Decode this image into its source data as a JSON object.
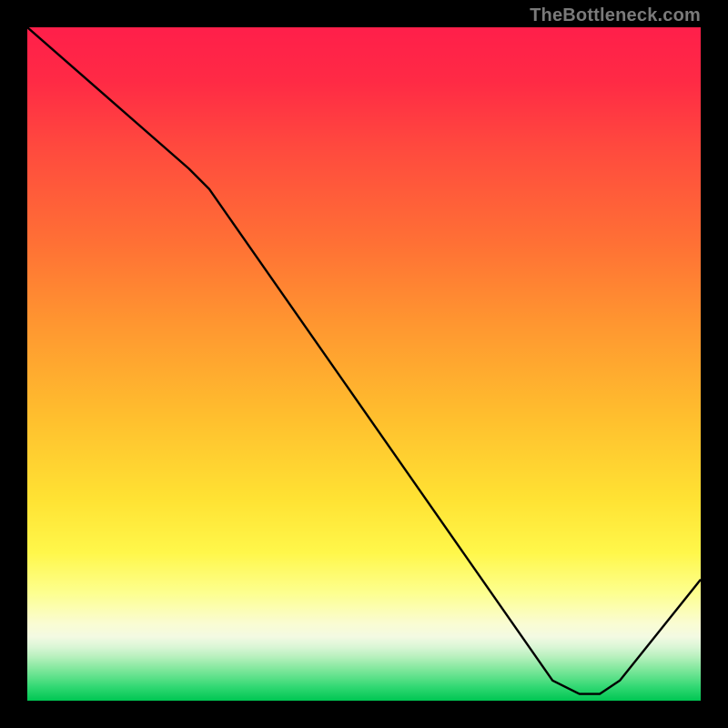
{
  "attribution": "TheBottleneck.com",
  "chart_data": {
    "type": "line",
    "title": "",
    "xlabel": "",
    "ylabel": "",
    "xlim": [
      0,
      100
    ],
    "ylim": [
      0,
      100
    ],
    "grid": false,
    "series": [
      {
        "name": "curve",
        "color": "#000000",
        "points": [
          {
            "x": 0,
            "y": 100
          },
          {
            "x": 24,
            "y": 79
          },
          {
            "x": 27,
            "y": 76
          },
          {
            "x": 78,
            "y": 3
          },
          {
            "x": 82,
            "y": 1
          },
          {
            "x": 85,
            "y": 1
          },
          {
            "x": 88,
            "y": 3
          },
          {
            "x": 100,
            "y": 18
          }
        ]
      }
    ],
    "valley_label": {
      "text": "",
      "x": 83
    }
  },
  "colors": {
    "top": "#ff1f4a",
    "mid": "#ffe233",
    "bottom": "#00c652",
    "curve": "#000000",
    "frame": "#000000"
  }
}
